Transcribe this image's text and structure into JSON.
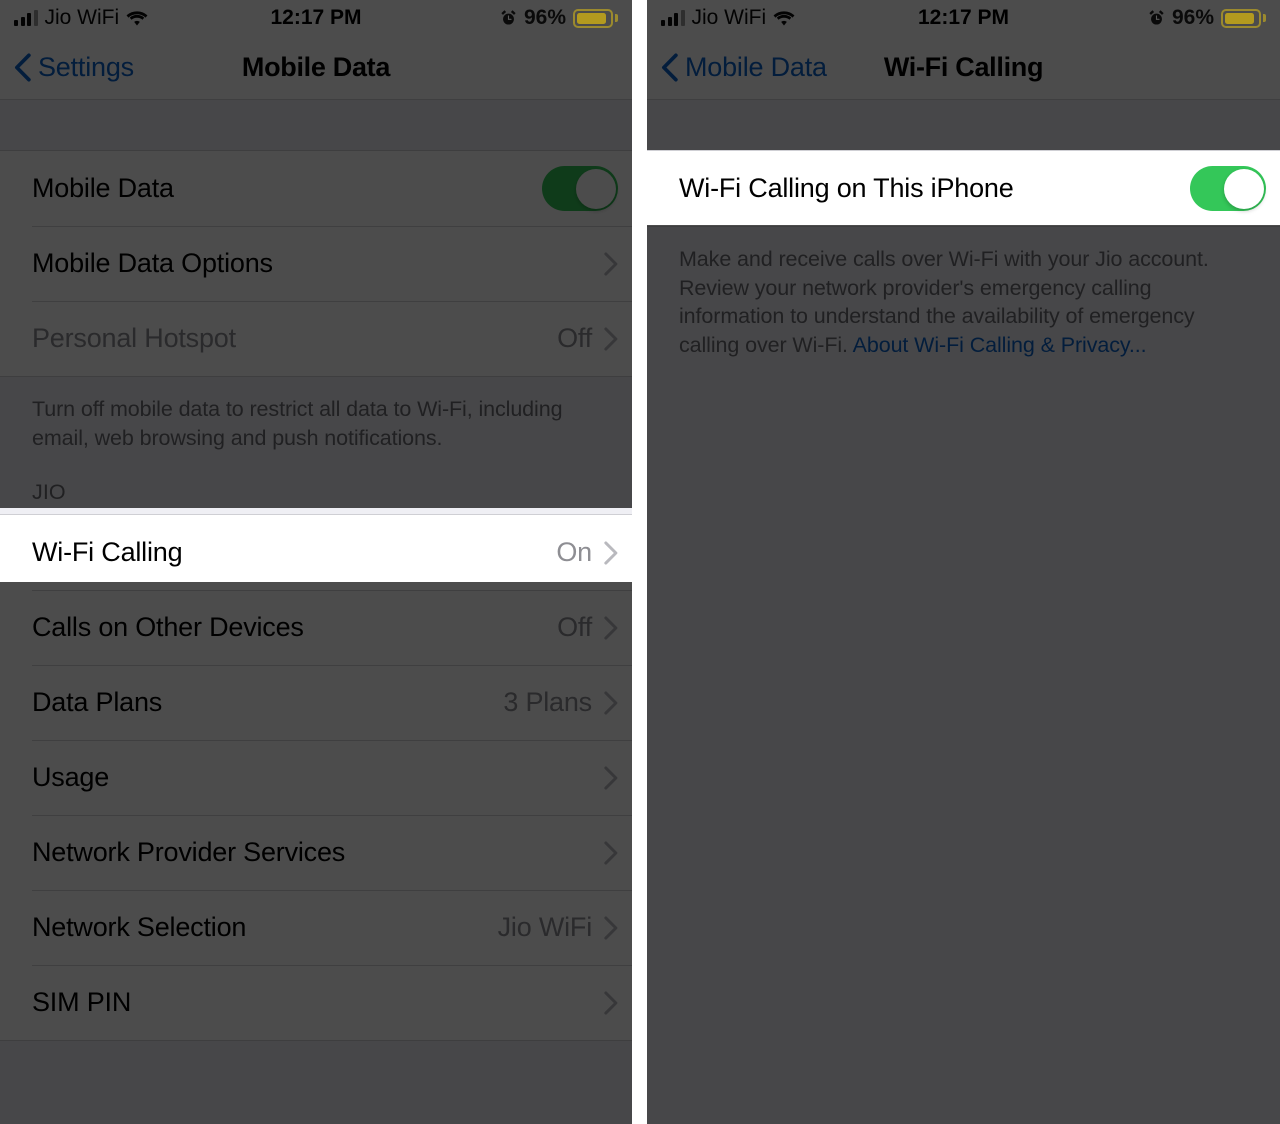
{
  "status_bar": {
    "carrier": "Jio WiFi",
    "time": "12:17 PM",
    "battery_percent": "96%",
    "signal_bars_filled": 3,
    "signal_bars_total": 4,
    "icons": {
      "signal": "signal-bars-icon",
      "wifi": "wifi-icon",
      "alarm": "alarm-clock-icon",
      "battery": "battery-icon"
    }
  },
  "left_panel": {
    "nav": {
      "back_label": "Settings",
      "title": "Mobile Data"
    },
    "group_one": [
      {
        "label": "Mobile Data",
        "type": "toggle",
        "value": "",
        "enabled": true,
        "dim_label": false
      },
      {
        "label": "Mobile Data Options",
        "type": "chevron",
        "value": "",
        "dim_label": false
      },
      {
        "label": "Personal Hotspot",
        "type": "chevron",
        "value": "Off",
        "dim_label": true
      }
    ],
    "group_one_footer": "Turn off mobile data to restrict all data to Wi-Fi, including email, web browsing and push notifications.",
    "group_two_header": "JIO",
    "group_two": [
      {
        "label": "Wi-Fi Calling",
        "type": "chevron",
        "value": "On",
        "highlighted": true
      },
      {
        "label": "Calls on Other Devices",
        "type": "chevron",
        "value": "Off",
        "highlighted": false
      },
      {
        "label": "Data Plans",
        "type": "chevron",
        "value": "3 Plans",
        "highlighted": false
      },
      {
        "label": "Usage",
        "type": "chevron",
        "value": "",
        "highlighted": false
      },
      {
        "label": "Network Provider Services",
        "type": "chevron",
        "value": "",
        "highlighted": false
      },
      {
        "label": "Network Selection",
        "type": "chevron",
        "value": "Jio WiFi",
        "highlighted": false
      },
      {
        "label": "SIM PIN",
        "type": "chevron",
        "value": "",
        "highlighted": false
      }
    ]
  },
  "right_panel": {
    "nav": {
      "back_label": "Mobile Data",
      "title": "Wi-Fi Calling"
    },
    "toggle_row": {
      "label": "Wi-Fi Calling on This iPhone",
      "enabled": true
    },
    "description": "Make and receive calls over Wi-Fi with your Jio account. Review your network provider's emergency calling information to understand the availability of emergency calling over Wi-Fi. ",
    "description_link": "About Wi-Fi Calling & Privacy..."
  },
  "colors": {
    "toggle_on": "#34C759",
    "link_blue": "#0B63C8",
    "tint_blue": "#0C63C9",
    "secondary_text": "#8E8E93",
    "table_background": "#EFEFF4",
    "battery_low_power": "#B39A1F",
    "dim_overlay": "rgba(0,0,0,0.70)"
  }
}
